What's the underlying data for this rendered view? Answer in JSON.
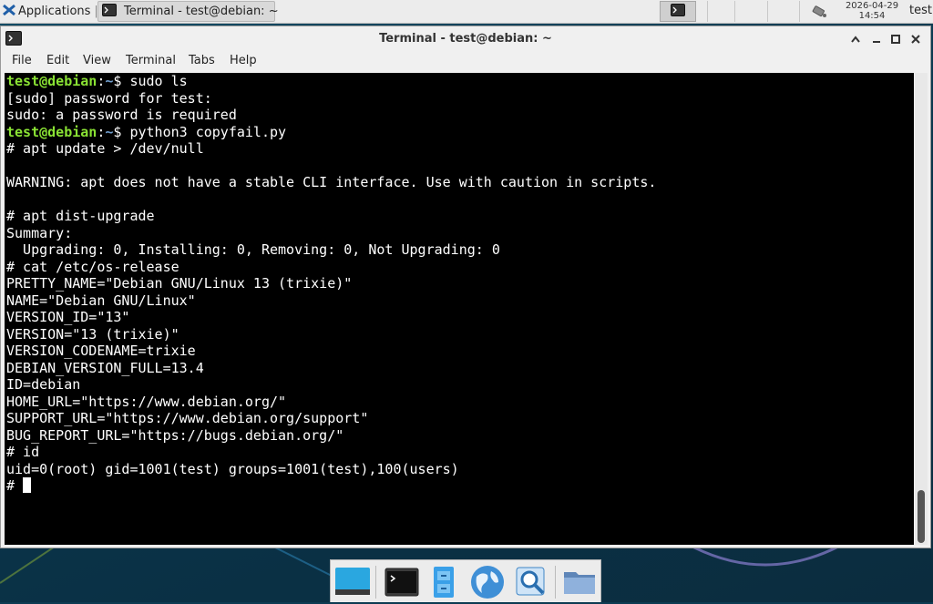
{
  "panel": {
    "applications_label": "Applications",
    "task_label": "Terminal - test@debian: ~",
    "clock_date": "2026-04-29",
    "clock_time": "14:54",
    "user": "test"
  },
  "window": {
    "title": "Terminal - test@debian: ~",
    "menu": [
      "File",
      "Edit",
      "View",
      "Terminal",
      "Tabs",
      "Help"
    ]
  },
  "terminal": {
    "prompt_user": "test@debian",
    "prompt_sep": ":",
    "prompt_path": "~",
    "prompt_dollar": "$ ",
    "cmd1": "sudo ls",
    "line_sudo_pw": "[sudo] password for test:",
    "line_sudo_req": "sudo: a password is required",
    "cmd2": "python3 copyfail.py",
    "lines": [
      "# apt update > /dev/null",
      "",
      "WARNING: apt does not have a stable CLI interface. Use with caution in scripts.",
      "",
      "# apt dist-upgrade",
      "Summary:",
      "  Upgrading: 0, Installing: 0, Removing: 0, Not Upgrading: 0",
      "# cat /etc/os-release",
      "PRETTY_NAME=\"Debian GNU/Linux 13 (trixie)\"",
      "NAME=\"Debian GNU/Linux\"",
      "VERSION_ID=\"13\"",
      "VERSION=\"13 (trixie)\"",
      "VERSION_CODENAME=trixie",
      "DEBIAN_VERSION_FULL=13.4",
      "ID=debian",
      "HOME_URL=\"https://www.debian.org/\"",
      "SUPPORT_URL=\"https://www.debian.org/support\"",
      "BUG_REPORT_URL=\"https://bugs.debian.org/\"",
      "# id",
      "uid=0(root) gid=1001(test) groups=1001(test),100(users)"
    ],
    "final_prompt": "# "
  },
  "dock": {
    "items": [
      "show-desktop-icon",
      "terminal-icon",
      "file-cabinet-icon",
      "web-browser-icon",
      "app-finder-icon",
      "folder-icon"
    ]
  },
  "colors": {
    "prompt_user": "#8ae234",
    "prompt_path": "#729fcf",
    "terminal_bg": "#000000"
  }
}
